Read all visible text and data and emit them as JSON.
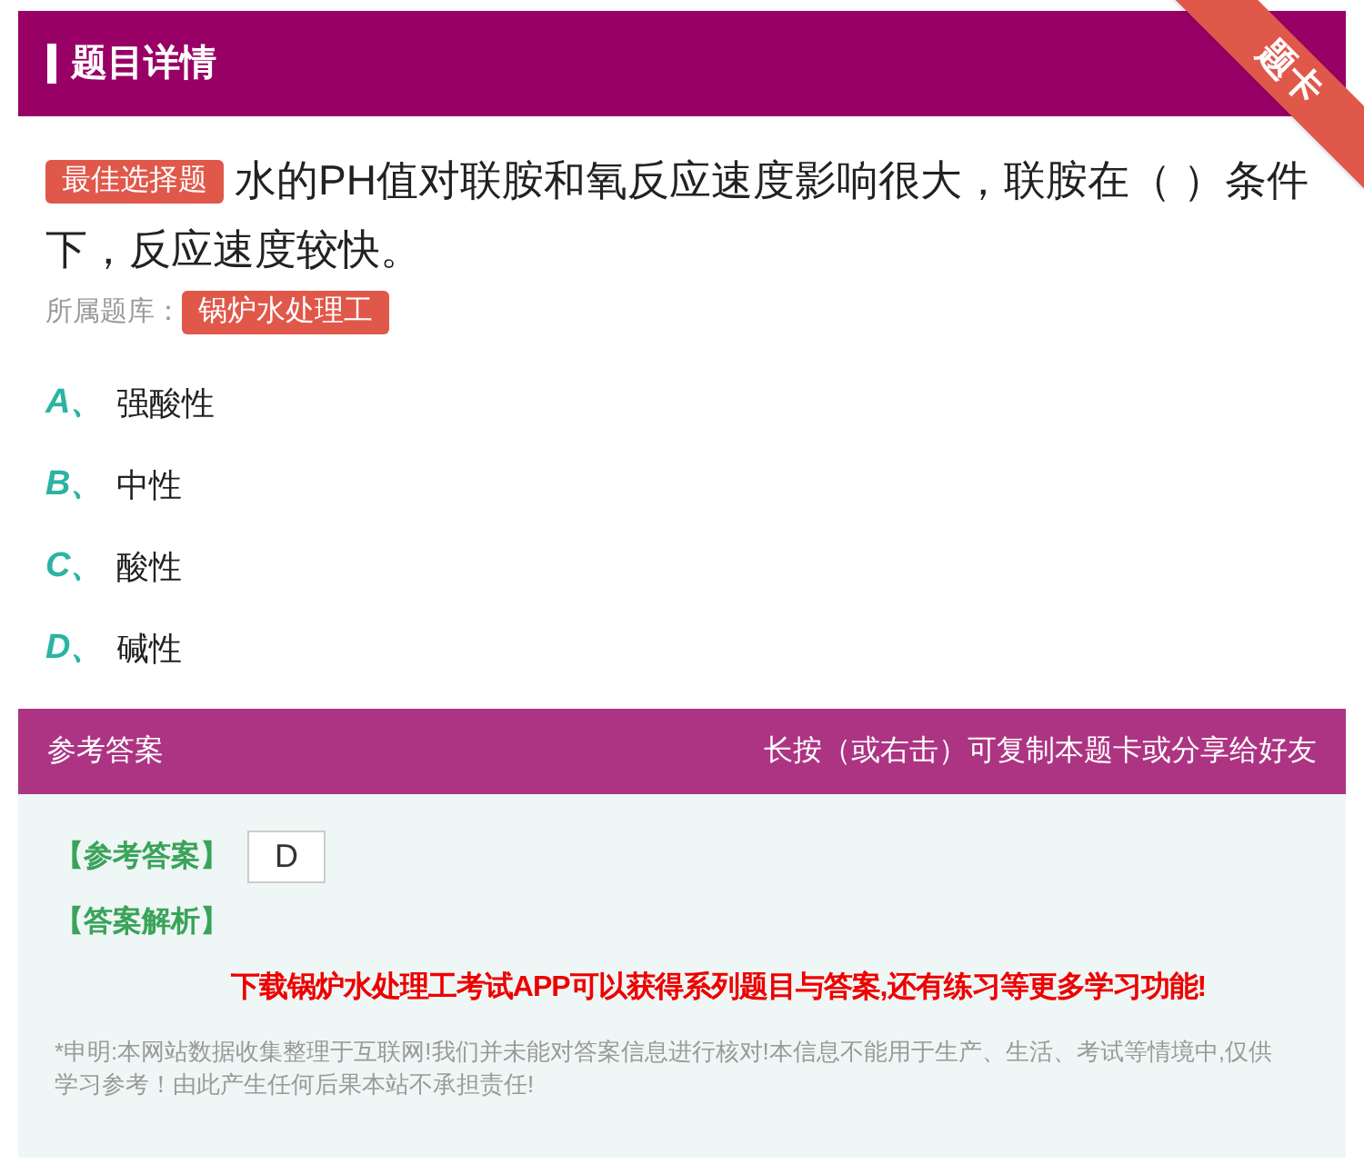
{
  "header": {
    "title": "题目详情",
    "ribbon": "题卡"
  },
  "question": {
    "type_tag": "最佳选择题",
    "text": "水的PH值对联胺和氧反应速度影响很大，联胺在（ ）条件下，反应速度较快。",
    "bank_label": "所属题库：",
    "bank": "锅炉水处理工"
  },
  "options": [
    {
      "letter": "A、",
      "text": "强酸性"
    },
    {
      "letter": "B、",
      "text": "中性"
    },
    {
      "letter": "C、",
      "text": "酸性"
    },
    {
      "letter": "D、",
      "text": "碱性"
    }
  ],
  "answer_bar": {
    "title": "参考答案",
    "hint": "长按（或右击）可复制本题卡或分享给好友"
  },
  "answer": {
    "label": "【参考答案】",
    "value": "D",
    "analysis_label": "【答案解析】",
    "promo": "下载锅炉水处理工考试APP可以获得系列题目与答案,还有练习等更多学习功能!",
    "disclaimer": "*申明:本网站数据收集整理于互联网!我们并未能对答案信息进行核对!本信息不能用于生产、生活、考试等情境中,仅供学习参考！由此产生任何后果本站不承担责任!"
  }
}
